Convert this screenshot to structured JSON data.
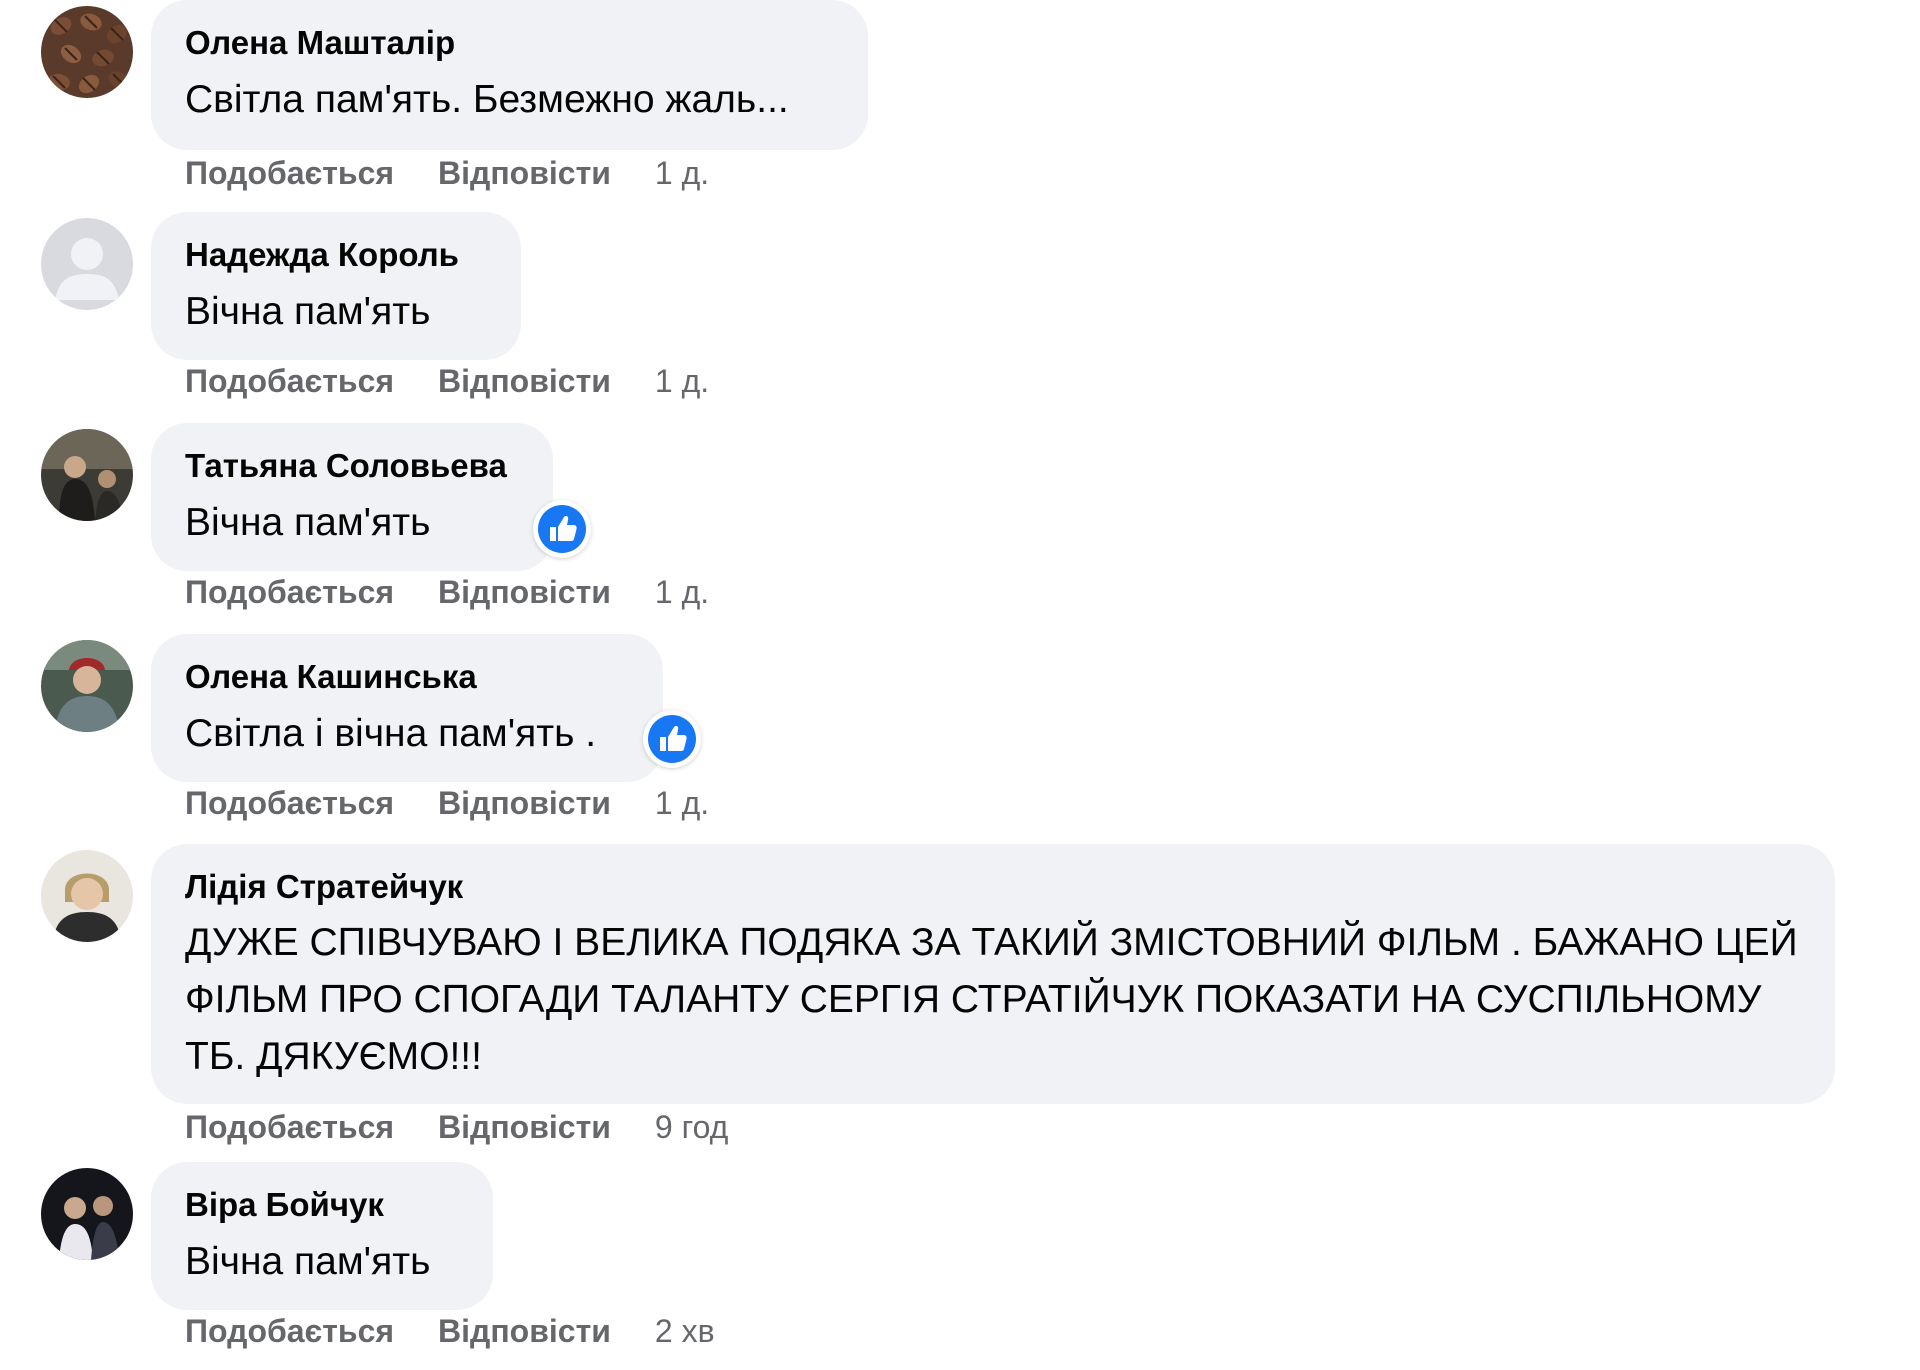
{
  "actions": {
    "like": "Подобається",
    "reply": "Відповісти"
  },
  "comments": [
    {
      "author": "Олена Машталір",
      "text": "Світла пам'ять. Безмежно жаль...",
      "time": "1 д.",
      "avatar": "coffee-beans",
      "reaction": null
    },
    {
      "author": "Надежда Король",
      "text": "Вічна пам'ять",
      "time": "1 д.",
      "avatar": "default-user",
      "reaction": null
    },
    {
      "author": "Татьяна Соловьева",
      "text": "Вічна пам'ять",
      "time": "1 д.",
      "avatar": "photo",
      "reaction": "like"
    },
    {
      "author": "Олена Кашинська",
      "text": "Світла і вічна пам'ять .",
      "time": "1 д.",
      "avatar": "photo",
      "reaction": "like"
    },
    {
      "author": "Лідія Стратейчук",
      "text": "ДУЖЕ СПІВЧУВАЮ І ВЕЛИКА ПОДЯКА ЗА ТАКИЙ ЗМІСТОВНИЙ ФІЛЬМ . БАЖАНО ЦЕЙ ФІЛЬМ ПРО СПОГАДИ ТАЛАНТУ СЕРГІЯ СТРАТІЙЧУК ПОКАЗАТИ НА СУСПІЛЬНОМУ ТБ. ДЯКУЄМО!!!",
      "time": "9 год",
      "avatar": "photo",
      "reaction": null
    },
    {
      "author": "Віра Бойчук",
      "text": "Вічна пам'ять",
      "time": "2 хв",
      "avatar": "photo",
      "reaction": null
    }
  ],
  "colors": {
    "bubble": "#f0f2f5",
    "meta": "#65676b",
    "like_blue": "#1877f2"
  }
}
